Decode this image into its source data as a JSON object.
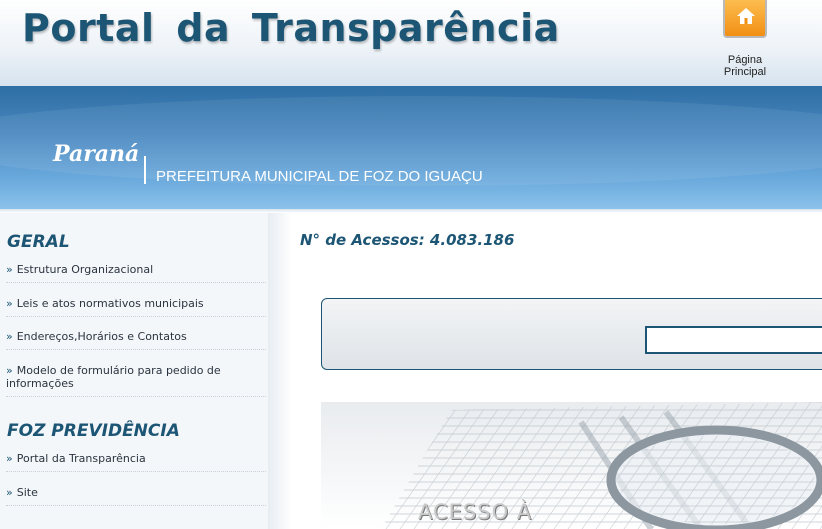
{
  "header": {
    "portal_title": "Portal  da  Transparência",
    "home_button_label_line1": "Página",
    "home_button_label_line2": "Principal",
    "home_icon": "home-icon"
  },
  "banner": {
    "state": "Paraná",
    "municipality": "PREFEITURA MUNICIPAL DE FOZ DO IGUAÇU"
  },
  "sidebar": {
    "sections": [
      {
        "title": "GERAL",
        "items": [
          {
            "label": "Estrutura Organizacional"
          },
          {
            "label": "Leis e atos normativos municipais"
          },
          {
            "label": "Endereços,Horários e Contatos"
          },
          {
            "label": "Modelo de formulário para pedido de informações"
          }
        ]
      },
      {
        "title": "FOZ PREVIDÊNCIA",
        "items": [
          {
            "label": "Portal da Transparência"
          },
          {
            "label": "Site"
          }
        ]
      }
    ],
    "bullet": "»"
  },
  "main": {
    "access_counter": "N° de Acessos: 4.083.186",
    "search_value": "",
    "promo_text": "ACESSO À"
  },
  "colors": {
    "brand_dark": "#1d5675",
    "banner_blue": "#4a88c0",
    "home_orange": "#f18f14"
  }
}
